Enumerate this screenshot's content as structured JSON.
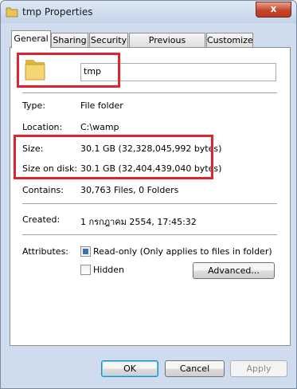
{
  "window": {
    "title": "tmp Properties",
    "close_glyph": "x",
    "icon": "folder-icon"
  },
  "tabs": [
    {
      "label": "General",
      "active": true
    },
    {
      "label": "Sharing"
    },
    {
      "label": "Security"
    },
    {
      "label": "Previous Versions"
    },
    {
      "label": "Customize"
    }
  ],
  "general": {
    "folder_icon": "folder-icon",
    "name_value": "tmp",
    "type_label": "Type:",
    "type_value": "File folder",
    "location_label": "Location:",
    "location_value": "C:\\wamp",
    "size_label": "Size:",
    "size_value": "30.1 GB (32,328,045,992 bytes)",
    "size_on_disk_label": "Size on disk:",
    "size_on_disk_value": "30.1 GB (32,404,439,040 bytes)",
    "contains_label": "Contains:",
    "contains_value": "30,763 Files, 0 Folders",
    "created_label": "Created:",
    "created_value": "1 กรกฎาคม 2554, 17:45:32",
    "attributes_label": "Attributes:",
    "readonly_label": "Read-only (Only applies to files in folder)",
    "readonly_state": "indeterminate",
    "hidden_label": "Hidden",
    "hidden_checked": false,
    "advanced_label": "Advanced..."
  },
  "footer": {
    "ok_label": "OK",
    "cancel_label": "Cancel",
    "apply_label": "Apply"
  },
  "colors": {
    "highlight": "#e0232e",
    "titlebar": "#cfdced",
    "close": "#c7462b"
  }
}
